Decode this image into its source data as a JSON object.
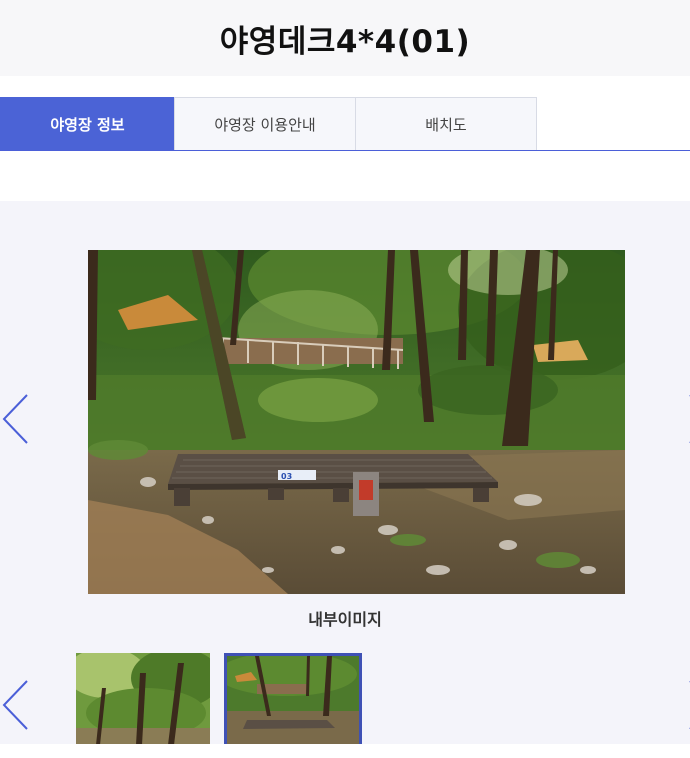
{
  "header": {
    "title": "야영데크4*4(01)"
  },
  "tabs": [
    {
      "label": "야영장 정보",
      "active": true
    },
    {
      "label": "야영장 이용안내",
      "active": false
    },
    {
      "label": "배치도",
      "active": false
    }
  ],
  "gallery": {
    "caption": "내부이미지",
    "deck_number": "03",
    "thumbnails": [
      {
        "selected": false
      },
      {
        "selected": true
      }
    ]
  },
  "colors": {
    "accent": "#4b63d6",
    "arrow": "#4b5fd8",
    "gallery_bg": "#f4f4fa"
  },
  "icons": {
    "prev": "chevron-left-icon",
    "next": "chevron-right-icon"
  }
}
